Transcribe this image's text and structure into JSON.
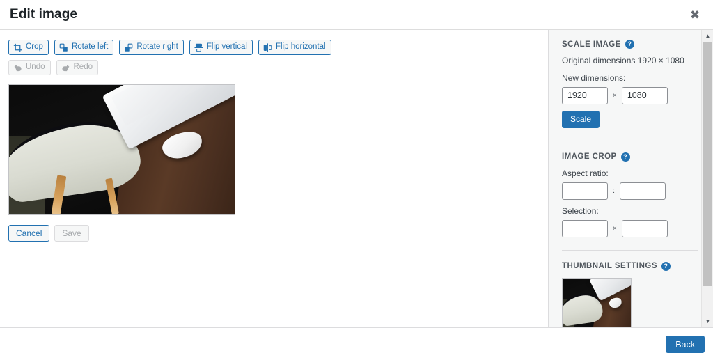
{
  "header": {
    "title": "Edit image",
    "close_label": "✖",
    "close_icon": "close-icon"
  },
  "toolbar": {
    "primary": [
      {
        "label": "Crop",
        "icon": "crop-icon",
        "disabled": false
      },
      {
        "label": "Rotate left",
        "icon": "rotate-left-icon",
        "disabled": false
      },
      {
        "label": "Rotate right",
        "icon": "rotate-right-icon",
        "disabled": false
      },
      {
        "label": "Flip vertical",
        "icon": "flip-vertical-icon",
        "disabled": false
      },
      {
        "label": "Flip horizontal",
        "icon": "flip-horizontal-icon",
        "disabled": false
      }
    ],
    "history": [
      {
        "label": "Undo",
        "icon": "undo-icon",
        "disabled": true
      },
      {
        "label": "Redo",
        "icon": "redo-icon",
        "disabled": true
      }
    ]
  },
  "editor": {
    "image_alt": "Photo of a white laptop and mouse on a dark wooden desk next to a white chair",
    "cancel_label": "Cancel",
    "save_label": "Save",
    "save_disabled": true
  },
  "sidebar": {
    "scale_image": {
      "title": "SCALE IMAGE",
      "help": "?",
      "original_dimensions_text": "Original dimensions 1920 × 1080",
      "new_dimensions_label": "New dimensions:",
      "width_value": "1920",
      "height_value": "1080",
      "separator": "×",
      "scale_label": "Scale"
    },
    "image_crop": {
      "title": "IMAGE CROP",
      "help": "?",
      "aspect_ratio_label": "Aspect ratio:",
      "aspect_width_value": "",
      "aspect_height_value": "",
      "aspect_separator": ":",
      "selection_label": "Selection:",
      "selection_width_value": "",
      "selection_height_value": "",
      "selection_separator": "×"
    },
    "thumbnail_settings": {
      "title": "THUMBNAIL SETTINGS",
      "help": "?"
    },
    "scrollbar": {
      "up_arrow": "▲",
      "down_arrow": "▼"
    }
  },
  "footer": {
    "back_label": "Back"
  },
  "colors": {
    "accent": "#2271b1",
    "text": "#3c434a",
    "muted": "#a7aaad",
    "panel_bg": "#f6f7f7",
    "border": "#dcdcde"
  }
}
